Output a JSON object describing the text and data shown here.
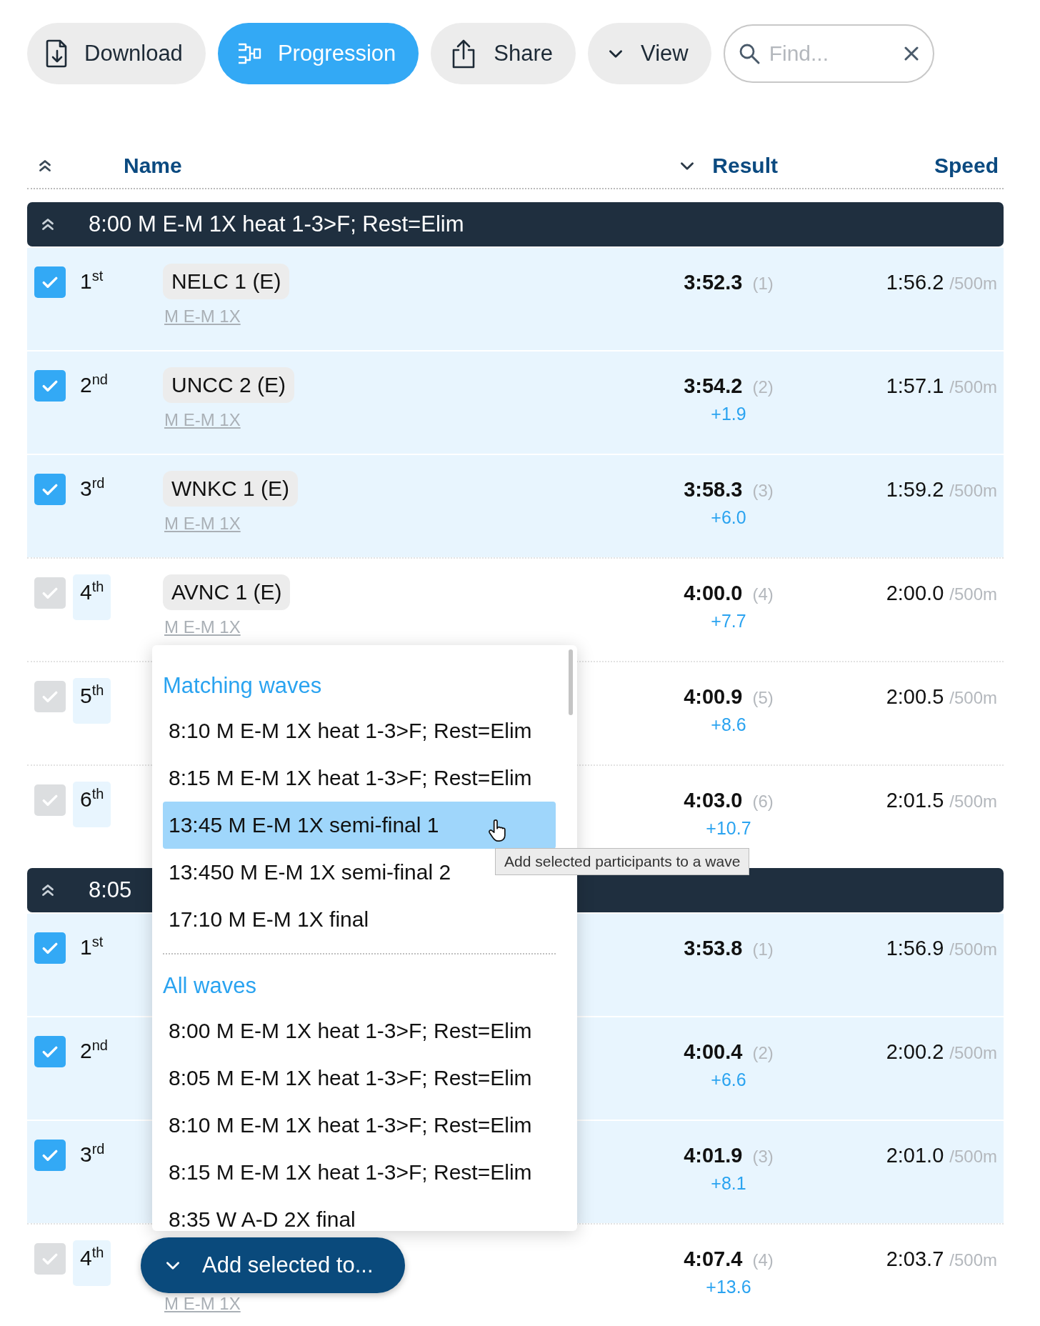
{
  "toolbar": {
    "buttons": [
      {
        "label": "Download",
        "selected": false
      },
      {
        "label": "Progression",
        "selected": true
      },
      {
        "label": "Share",
        "selected": false
      },
      {
        "label": "View",
        "selected": false
      }
    ],
    "search": {
      "placeholder": "Find..."
    }
  },
  "table": {
    "columns": [
      {
        "label": "Name",
        "sorted": false
      },
      {
        "label": "Result",
        "sorted": true
      },
      {
        "label": "Speed",
        "sorted": false
      }
    ],
    "groups": [
      {
        "title": "8:00 M E-M 1X heat 1-3>F; Rest=Elim",
        "expanded": true,
        "rows": [
          {
            "checked": true,
            "rank": "1$^{st}$",
            "name": "NELC 1 (E)",
            "category": "M E-M 1X",
            "result": "3:52.3",
            "place": "(1)",
            "speed": "1:56.2",
            "unit": "/500m"
          },
          {
            "checked": true,
            "rank": "2$^{nd}$",
            "name": "UNCC 2 (E)",
            "category": "M E-M 1X",
            "result": "3:54.2",
            "place": "(2)",
            "gap": "+1.9",
            "speed": "1:57.1",
            "unit": "/500m"
          },
          {
            "checked": true,
            "rank": "3$^{rd}$",
            "name": "WNKC 1 (E)",
            "category": "M E-M 1X",
            "result": "3:58.3",
            "place": "(3)",
            "gap": "+6.0",
            "speed": "1:59.2",
            "unit": "/500m"
          },
          {
            "checked": false,
            "rank": "4$^{th}$",
            "name": "AVNC 1 (E)",
            "category": "M E-M 1X",
            "result": "4:00.0",
            "place": "(4)",
            "gap": "+7.7",
            "speed": "2:00.0",
            "unit": "/500m"
          },
          {
            "checked": false,
            "rank": "5$^{th}$",
            "result": "4:00.9",
            "place": "(5)",
            "gap": "+8.6",
            "speed": "2:00.5",
            "unit": "/500m"
          },
          {
            "checked": false,
            "rank": "6$^{th}$",
            "result": "4:03.0",
            "place": "(6)",
            "gap": "+10.7",
            "speed": "2:01.5",
            "unit": "/500m"
          }
        ]
      },
      {
        "title": "8:05",
        "expanded": true,
        "rows": [
          {
            "checked": true,
            "rank": "1$^{st}$",
            "result": "3:53.8",
            "place": "(1)",
            "speed": "1:56.9",
            "unit": "/500m"
          },
          {
            "checked": true,
            "rank": "2$^{nd}$",
            "result": "4:00.4",
            "place": "(2)",
            "gap": "+6.6",
            "speed": "2:00.2",
            "unit": "/500m"
          },
          {
            "checked": true,
            "rank": "3$^{rd}$",
            "result": "4:01.9",
            "place": "(3)",
            "gap": "+8.1",
            "speed": "2:01.0",
            "unit": "/500m"
          },
          {
            "checked": false,
            "rank": "4$^{th}$",
            "category": "M E-M 1X",
            "result": "4:07.4",
            "place": "(4)",
            "gap": "+13.6",
            "speed": "2:03.7",
            "unit": "/500m"
          }
        ]
      }
    ]
  },
  "wave_menu": {
    "sections": [
      {
        "title": "Matching waves",
        "items": [
          {
            "label": "8:10 M E-M 1X heat 1-3>F; Rest=Elim",
            "selected": false
          },
          {
            "label": "8:15 M E-M 1X heat 1-3>F; Rest=Elim",
            "selected": false
          },
          {
            "label": "13:45 M E-M 1X semi-final 1",
            "selected": true
          },
          {
            "label": "13:450 M E-M 1X semi-final 2",
            "selected": false
          },
          {
            "label": "17:10 M E-M 1X final",
            "selected": false
          }
        ]
      },
      {
        "title": "All waves",
        "items": [
          {
            "label": "8:00 M E-M 1X heat 1-3>F; Rest=Elim",
            "selected": false
          },
          {
            "label": "8:05 M E-M 1X heat 1-3>F; Rest=Elim",
            "selected": false
          },
          {
            "label": "8:10 M E-M 1X heat 1-3>F; Rest=Elim",
            "selected": false
          },
          {
            "label": "8:15 M E-M 1X heat 1-3>F; Rest=Elim",
            "selected": false
          },
          {
            "label": "8:35 W A-D 2X final",
            "selected": false
          }
        ]
      }
    ]
  },
  "tooltip": "Add selected participants to a wave",
  "add_button": {
    "label": "Add selected to..."
  }
}
